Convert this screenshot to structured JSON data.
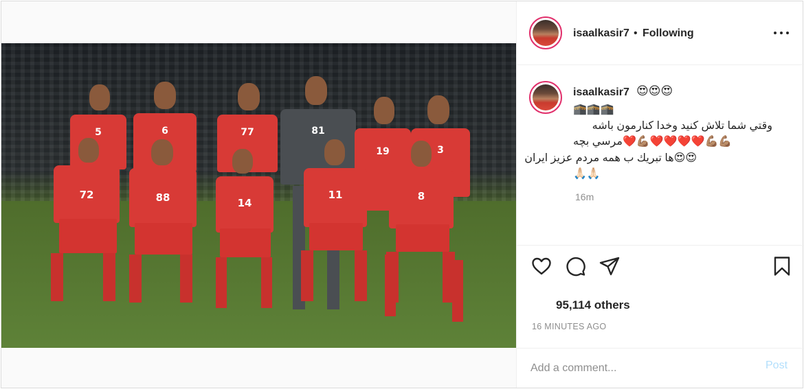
{
  "post": {
    "username": "isaalkasir7",
    "follow_status": "Following",
    "dot": "•",
    "caption": {
      "username": "isaalkasir7",
      "emoji_after_name": "😍😍😍",
      "lines": [
        "🕋🕋🕋",
        "وقتي شما تلاش كنيد وخدا كنارمون باشه",
        "💪🏽💪🏽❤️❤️❤️❤️💪🏽❤️مرسي بچه",
        "😍😍ها تبريك ب همه مردم عزيز ايران",
        "🙏🏻🙏🏻"
      ]
    },
    "comment_time": "16m",
    "likes": "95,114 others",
    "posted_ago": "16 MINUTES AGO",
    "comment_placeholder": "Add a comment...",
    "post_button": "Post"
  },
  "photo": {
    "jersey_numbers_back_row": [
      "5",
      "6",
      "77",
      "81",
      "19",
      "3"
    ],
    "jersey_numbers_front_row": [
      "72",
      "88",
      "14",
      "11",
      "8"
    ],
    "kit_color": "#d83a36",
    "gk_color": "#4a4e52"
  },
  "icons": {
    "more": "more-options-icon",
    "like": "heart-icon",
    "comment": "comment-icon",
    "share": "paper-plane-icon",
    "save": "bookmark-icon"
  },
  "colors": {
    "accent_ring": "#e1306c",
    "post_button_disabled": "#b2dffc",
    "muted_text": "#8e8e8e"
  }
}
